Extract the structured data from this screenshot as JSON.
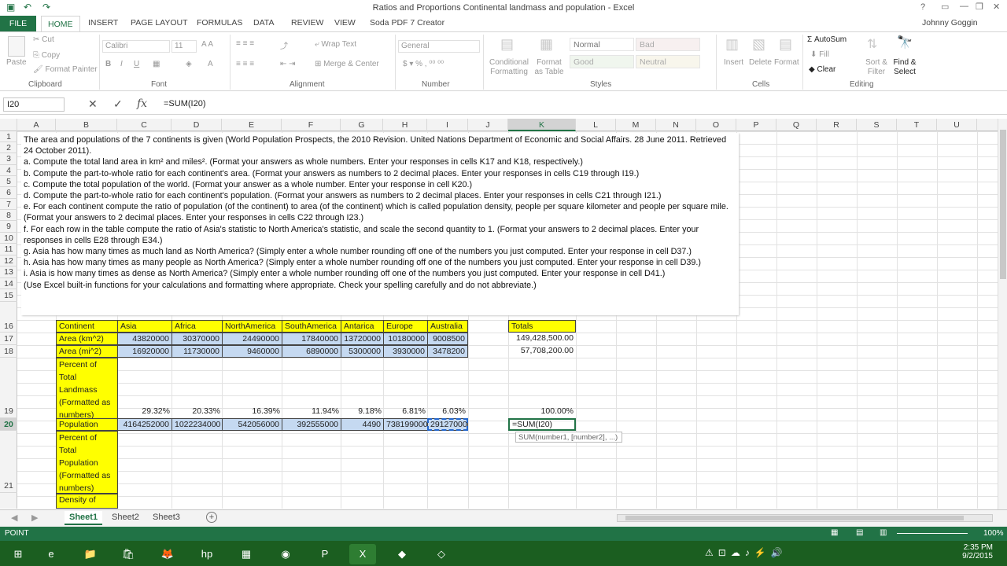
{
  "window": {
    "title": "Ratios and Proportions Continental landmass and population - Excel",
    "user": "Johnny Goggin"
  },
  "tabs": [
    "FILE",
    "HOME",
    "INSERT",
    "PAGE LAYOUT",
    "FORMULAS",
    "DATA",
    "REVIEW",
    "VIEW",
    "Soda PDF 7 Creator"
  ],
  "ribbon": {
    "clipboard": {
      "paste": "Paste",
      "cut": "Cut",
      "copy": "Copy",
      "format_painter": "Format Painter",
      "group": "Clipboard"
    },
    "font": {
      "name": "Calibri",
      "size": "11",
      "group": "Font"
    },
    "alignment": {
      "wrap": "Wrap Text",
      "merge": "Merge & Center",
      "group": "Alignment"
    },
    "number": {
      "format": "General",
      "group": "Number"
    },
    "styles": {
      "conditional": "Conditional Formatting",
      "format_table": "Format as Table",
      "normal": "Normal",
      "bad": "Bad",
      "good": "Good",
      "neutral": "Neutral",
      "group": "Styles"
    },
    "cells": {
      "insert": "Insert",
      "delete": "Delete",
      "format": "Format",
      "group": "Cells"
    },
    "editing": {
      "autosum": "AutoSum",
      "fill": "Fill",
      "clear": "Clear",
      "sort": "Sort & Filter",
      "find": "Find & Select",
      "group": "Editing"
    }
  },
  "formula_bar": {
    "name_box": "I20",
    "formula": "=SUM(I20)"
  },
  "columns": [
    "A",
    "B",
    "C",
    "D",
    "E",
    "F",
    "G",
    "H",
    "I",
    "J",
    "K",
    "L",
    "M",
    "N",
    "O",
    "P",
    "Q",
    "R",
    "S",
    "T",
    "U"
  ],
  "rows": [
    "1",
    "2",
    "3",
    "4",
    "5",
    "6",
    "7",
    "8",
    "9",
    "10",
    "11",
    "12",
    "13",
    "14",
    "15",
    "16",
    "17",
    "18",
    "19",
    "20",
    "21"
  ],
  "instructions": [
    "The area and populations of the 7 continents is given (World Population Prospects, the 2010 Revision. United Nations Department of Economic and Social Affairs. 28 June 2011. Retrieved 24 October 2011).",
    "a. Compute the total land area in km² and miles². (Format your answers as whole numbers. Enter your responses in cells K17 and K18, respectively.)",
    "b. Compute the part-to-whole ratio for each continent's area. (Format your answers as numbers to 2 decimal places. Enter your responses in cells C19 through I19.)",
    "c. Compute the total population of the world. (Format your answer as a whole number. Enter your response in cell K20.)",
    "d. Compute the part-to-whole ratio for each continent's population. (Format your answers as numbers to 2 decimal places. Enter your responses in cells C21 through I21.)",
    "e. For each continent compute the ratio of population (of the continent) to area (of the continent) which is called population density, people per square kilometer and people per square mile. (Format your answers to 2 decimal places. Enter your responses in cells C22 through I23.)",
    "f. For each row in the table compute the ratio of Asia's statistic to North America's statistic, and scale the second quantity to 1. (Format your answers to 2 decimal places. Enter your responses in cells E28 through E34.)",
    "g. Asia has how many times as much land as North America? (Simply enter a whole number rounding off one of the numbers you just computed. Enter your response in cell D37.)",
    "h. Asia has how many times as many people as North America? (Simply enter a whole number rounding off one of the numbers you just computed. Enter your response in cell D39.)",
    "i. Asia is how many times as dense as North America? (Simply enter a whole number rounding off one of the numbers you just computed. Enter your response in cell D41.)",
    "(Use Excel built-in functions for your calculations and formatting where appropriate. Check your spelling carefully and do not abbreviate.)"
  ],
  "table": {
    "header": [
      "Continent",
      "Asia",
      "Africa",
      "NorthAmerica",
      "SouthAmerica",
      "Antarica",
      "Europe",
      "Australia"
    ],
    "area_km_label": "Area (km^2)",
    "area_km": [
      "43820000",
      "30370000",
      "24490000",
      "17840000",
      "13720000",
      "10180000",
      "9008500"
    ],
    "area_mi_label": "Area (mi^2)",
    "area_mi": [
      "16920000",
      "11730000",
      "9460000",
      "6890000",
      "5300000",
      "3930000",
      "3478200"
    ],
    "pct_land_label": [
      "Percent of",
      "Total",
      "Landmass",
      "(Formatted as",
      "numbers)"
    ],
    "pct_land": [
      "29.32%",
      "20.33%",
      "16.39%",
      "11.94%",
      "9.18%",
      "6.81%",
      "6.03%"
    ],
    "population_label": "Population",
    "population": [
      "4164252000",
      "1022234000",
      "542056000",
      "392555000",
      "4490",
      "738199000",
      "29127000"
    ],
    "pct_pop_label": [
      "Percent of",
      "Total",
      "Population",
      "(Formatted as",
      "numbers)"
    ],
    "density_label": "Density of",
    "totals_label": "Totals",
    "total_km": "149,428,500.00",
    "total_mi": "57,708,200.00",
    "total_pct": "100.00%",
    "editing": "=SUM(I20)",
    "tooltip": "SUM(number1, [number2], ...)"
  },
  "sheets": [
    "Sheet1",
    "Sheet2",
    "Sheet3"
  ],
  "status": {
    "mode": "POINT",
    "zoom": "100%"
  },
  "clock": {
    "time": "2:35 PM",
    "date": "9/2/2015"
  }
}
